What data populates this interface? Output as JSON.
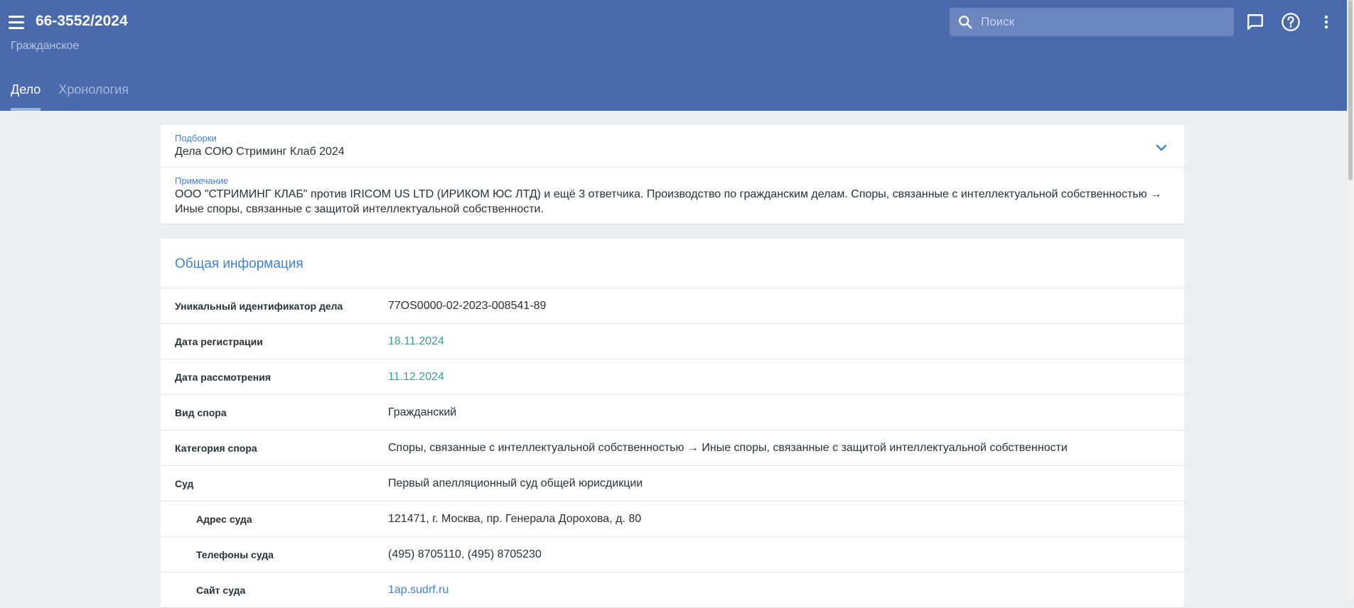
{
  "header": {
    "title": "66-3552/2024",
    "subtitle": "Гражданское",
    "search_placeholder": "Поиск",
    "icons": [
      "menu-icon",
      "search-icon",
      "chat-icon",
      "help-icon",
      "more-vert-icon"
    ],
    "bg_color": "#4a6aae"
  },
  "tabs": [
    {
      "label": "Дело",
      "active": true
    },
    {
      "label": "Хронология",
      "active": false
    }
  ],
  "collections": {
    "label": "Подборки",
    "value": "Дела СОЮ Стриминг Клаб 2024"
  },
  "note": {
    "label": "Примечание",
    "value": "ООО \"СТРИМИНГ КЛАБ\" против IRICOM US LTD (ИРИКОМ ЮС ЛТД) и ещё 3 ответчика. Производство по гражданским делам. Споры, связанные с интеллектуальной собственностью → Иные споры, связанные с защитой интеллектуальной собственности."
  },
  "general_info": {
    "title": "Общая информация",
    "rows": [
      {
        "key": "Уникальный идентификатор дела",
        "value": "77OS0000-02-2023-008541-89"
      },
      {
        "key": "Дата регистрации",
        "value": "18.11.2024"
      },
      {
        "key": "Дата рассмотрения",
        "value": "11.12.2024"
      },
      {
        "key": "Вид спора",
        "value": "Гражданский"
      },
      {
        "key": "Категория спора",
        "value": "Споры, связанные с интеллектуальной собственностью → Иные споры, связанные с защитой интеллектуальной собственности"
      },
      {
        "key": "Суд",
        "value": "Первый апелляционный суд общей юрисдикции"
      },
      {
        "key": "Адрес суда",
        "value": "121471, г. Москва, пр. Генерала Дорохова, д. 80"
      },
      {
        "key": "Телефоны суда",
        "value": "(495) 8705110, (495) 8705230"
      },
      {
        "key": "Сайт суда",
        "value": "1ap.sudrf.ru"
      }
    ]
  }
}
